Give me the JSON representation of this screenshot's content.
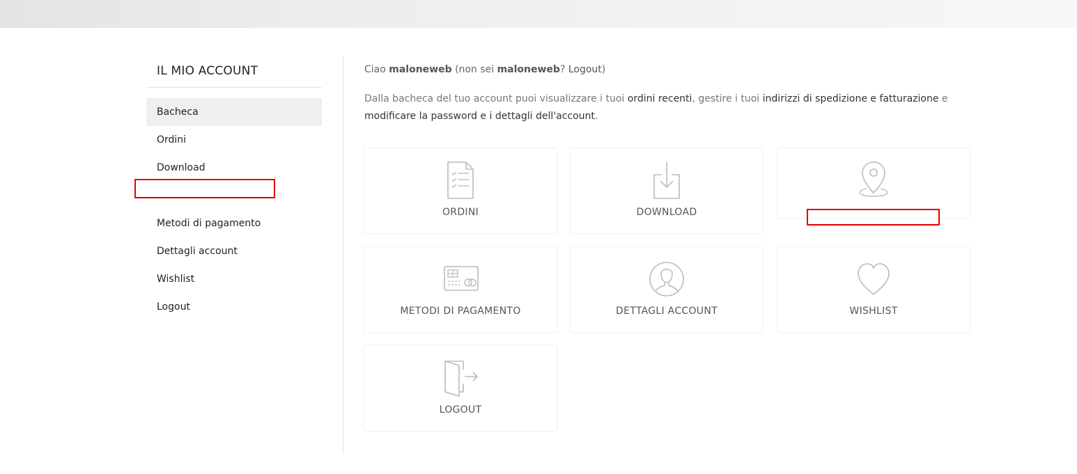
{
  "sidebar": {
    "title": "IL MIO ACCOUNT",
    "items": [
      {
        "label": "Bacheca",
        "active": true
      },
      {
        "label": "Ordini"
      },
      {
        "label": "Download"
      },
      {
        "label": ""
      },
      {
        "label": "Metodi di pagamento"
      },
      {
        "label": "Dettagli account"
      },
      {
        "label": "Wishlist"
      },
      {
        "label": "Logout"
      }
    ]
  },
  "main": {
    "greeting": {
      "prefix": "Ciao ",
      "username": "maloneweb",
      "middle": " (non sei ",
      "username2": "maloneweb",
      "question": "? ",
      "logout": "Logout",
      "suffix": ")"
    },
    "intro": {
      "part1": "Dalla bacheca del tuo account puoi visualizzare i tuoi ",
      "link1": "ordini recenti",
      "part2": ", gestire i tuoi ",
      "link2": "indirizzi di spedizione e fatturazione",
      "part3": " e ",
      "link3": "modificare la password e i dettagli dell'account",
      "part4": "."
    },
    "tiles": [
      {
        "label": "ORDINI",
        "icon": "orders-icon"
      },
      {
        "label": "DOWNLOAD",
        "icon": "download-icon"
      },
      {
        "label": "",
        "icon": "location-pin-icon"
      },
      {
        "label": "METODI DI PAGAMENTO",
        "icon": "credit-card-icon"
      },
      {
        "label": "DETTAGLI ACCOUNT",
        "icon": "user-icon"
      },
      {
        "label": "WISHLIST",
        "icon": "heart-icon"
      },
      {
        "label": "LOGOUT",
        "icon": "logout-door-icon"
      }
    ]
  },
  "colors": {
    "highlight_box": "#e00000",
    "icon_stroke": "#bbbbbb",
    "active_nav_bg": "#efefef"
  }
}
